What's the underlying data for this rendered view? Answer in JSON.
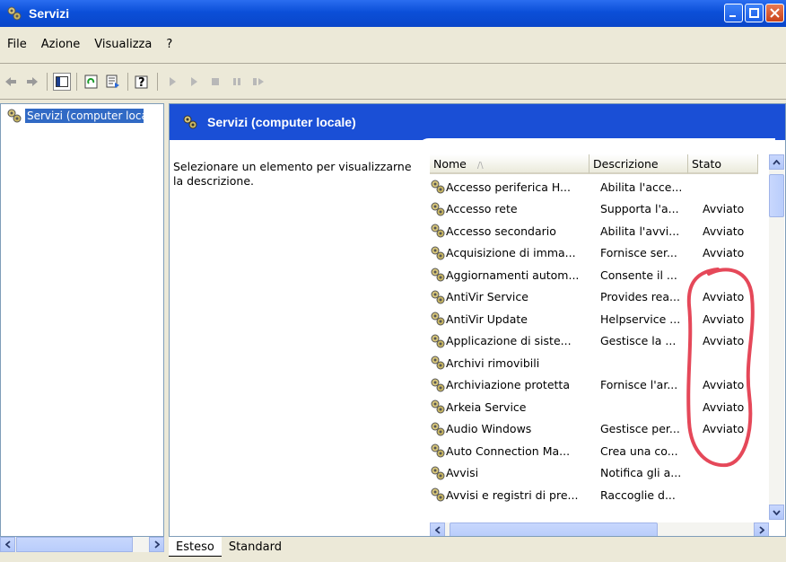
{
  "window": {
    "title": "Servizi"
  },
  "menu": {
    "items": [
      "File",
      "Azione",
      "Visualizza",
      "?"
    ]
  },
  "tree": {
    "selected_label": "Servizi (computer locale)"
  },
  "panel": {
    "header_title": "Servizi (computer locale)",
    "description": "Selezionare un elemento per visualizzarne la descrizione."
  },
  "columns": {
    "name": "Nome",
    "sort_indicator": "/\\",
    "description": "Descrizione",
    "status": "Stato"
  },
  "services": [
    {
      "name": "Accesso periferica H...",
      "description": "Abilita l'acce...",
      "status": ""
    },
    {
      "name": "Accesso rete",
      "description": "Supporta l'a...",
      "status": "Avviato"
    },
    {
      "name": "Accesso secondario",
      "description": "Abilita l'avvi...",
      "status": "Avviato"
    },
    {
      "name": "Acquisizione di imma...",
      "description": "Fornisce ser...",
      "status": "Avviato"
    },
    {
      "name": "Aggiornamenti autom...",
      "description": "Consente il ...",
      "status": ""
    },
    {
      "name": "AntiVir Service",
      "description": "Provides rea...",
      "status": "Avviato"
    },
    {
      "name": "AntiVir Update",
      "description": "Helpservice ...",
      "status": "Avviato"
    },
    {
      "name": "Applicazione di siste...",
      "description": "Gestisce la ...",
      "status": "Avviato"
    },
    {
      "name": "Archivi rimovibili",
      "description": "",
      "status": ""
    },
    {
      "name": "Archiviazione protetta",
      "description": "Fornisce l'ar...",
      "status": "Avviato"
    },
    {
      "name": "Arkeia Service",
      "description": "",
      "status": "Avviato"
    },
    {
      "name": "Audio Windows",
      "description": "Gestisce per...",
      "status": "Avviato"
    },
    {
      "name": "Auto Connection Ma...",
      "description": "Crea una co...",
      "status": ""
    },
    {
      "name": "Avvisi",
      "description": "Notifica gli a...",
      "status": ""
    },
    {
      "name": "Avvisi e registri di pre...",
      "description": "Raccoglie d...",
      "status": ""
    }
  ],
  "tabs": [
    "Esteso",
    "Standard"
  ],
  "colors": {
    "title_bar": "#0b4fd8",
    "header_band": "#1a4fd6",
    "selection": "#316ac5",
    "annotation": "#e0283c"
  }
}
